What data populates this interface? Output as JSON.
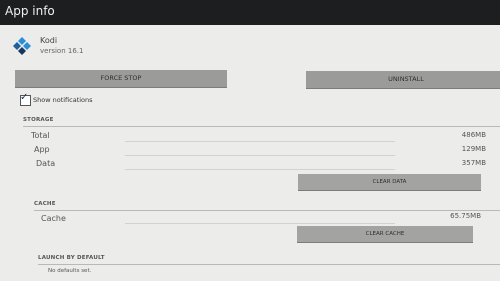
{
  "header": {
    "title": "App info"
  },
  "app": {
    "name": "Kodi",
    "version": "version 16.1",
    "icon": "kodi-logo-icon"
  },
  "actions": {
    "force_stop": "FORCE STOP",
    "uninstall": "UNINSTALL"
  },
  "notifications": {
    "label": "Show notifications",
    "checked": true
  },
  "storage": {
    "heading": "STORAGE",
    "rows": [
      {
        "label": "Total",
        "value": "486MB"
      },
      {
        "label": "App",
        "value": "129MB"
      },
      {
        "label": "Data",
        "value": "357MB"
      }
    ],
    "clear_data": "CLEAR DATA"
  },
  "cache": {
    "heading": "CACHE",
    "row": {
      "label": "Cache",
      "value": "65.75MB"
    },
    "clear_cache": "CLEAR CACHE"
  },
  "launch": {
    "heading": "LAUNCH BY DEFAULT",
    "text": "No defaults set."
  },
  "colors": {
    "topbar": "#1c1e1f",
    "background": "#ececea",
    "button": "#9b9c9a",
    "accent": "#17355f"
  }
}
